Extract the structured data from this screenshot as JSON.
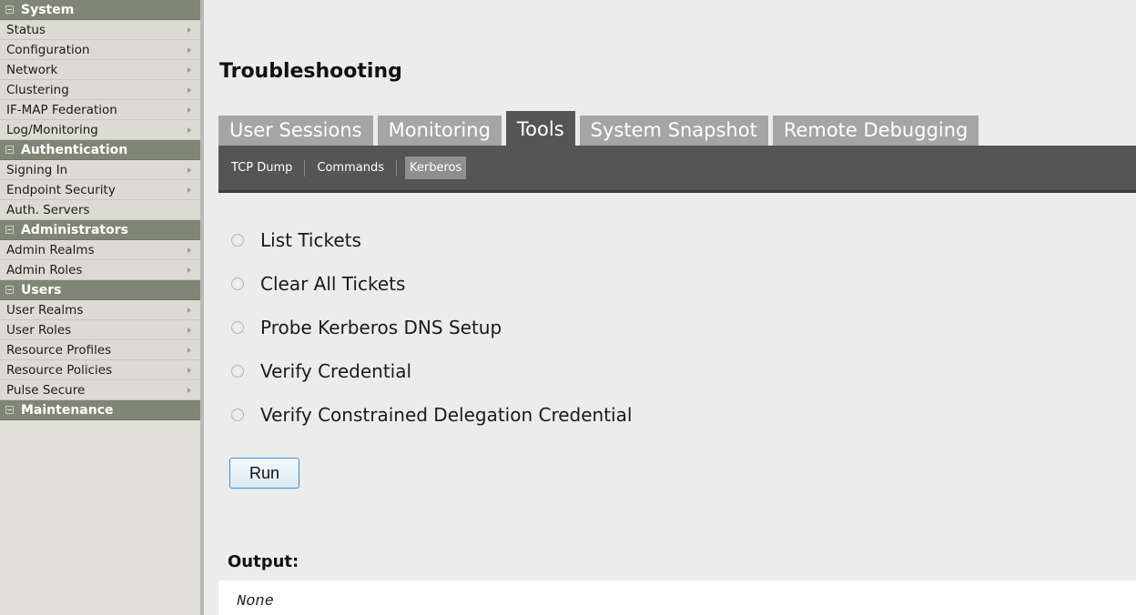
{
  "sidebar": {
    "sections": [
      {
        "title": "System",
        "items": [
          {
            "label": "Status",
            "arrow": true
          },
          {
            "label": "Configuration",
            "arrow": true
          },
          {
            "label": "Network",
            "arrow": true
          },
          {
            "label": "Clustering",
            "arrow": true
          },
          {
            "label": "IF-MAP Federation",
            "arrow": true
          },
          {
            "label": "Log/Monitoring",
            "arrow": true
          }
        ]
      },
      {
        "title": "Authentication",
        "items": [
          {
            "label": "Signing In",
            "arrow": true
          },
          {
            "label": "Endpoint Security",
            "arrow": true
          },
          {
            "label": "Auth. Servers",
            "arrow": false
          }
        ]
      },
      {
        "title": "Administrators",
        "items": [
          {
            "label": "Admin Realms",
            "arrow": true
          },
          {
            "label": "Admin Roles",
            "arrow": true
          }
        ]
      },
      {
        "title": "Users",
        "items": [
          {
            "label": "User Realms",
            "arrow": true
          },
          {
            "label": "User Roles",
            "arrow": true
          },
          {
            "label": "Resource Profiles",
            "arrow": true
          },
          {
            "label": "Resource Policies",
            "arrow": true
          },
          {
            "label": "Pulse Secure",
            "arrow": true
          }
        ]
      },
      {
        "title": "Maintenance",
        "items": []
      }
    ]
  },
  "page": {
    "title": "Troubleshooting"
  },
  "tabs": [
    {
      "label": "User Sessions",
      "active": false
    },
    {
      "label": "Monitoring",
      "active": false
    },
    {
      "label": "Tools",
      "active": true
    },
    {
      "label": "System Snapshot",
      "active": false
    },
    {
      "label": "Remote Debugging",
      "active": false
    }
  ],
  "subnav": [
    {
      "label": "TCP Dump",
      "active": false
    },
    {
      "label": "Commands",
      "active": false
    },
    {
      "label": "Kerberos",
      "active": true
    }
  ],
  "options": [
    {
      "label": "List Tickets",
      "checked": false
    },
    {
      "label": "Clear All Tickets",
      "checked": false
    },
    {
      "label": "Probe Kerberos DNS Setup",
      "checked": false
    },
    {
      "label": "Verify Credential",
      "checked": false
    },
    {
      "label": "Verify Constrained Delegation Credential",
      "checked": false
    }
  ],
  "run_button": {
    "label": "Run"
  },
  "output": {
    "label": "Output:",
    "value": "None"
  },
  "colors": {
    "section_header": "#808575",
    "tab_active": "#555555",
    "tab_inactive": "#a5a5a5",
    "button_border": "#3c8fd2"
  }
}
